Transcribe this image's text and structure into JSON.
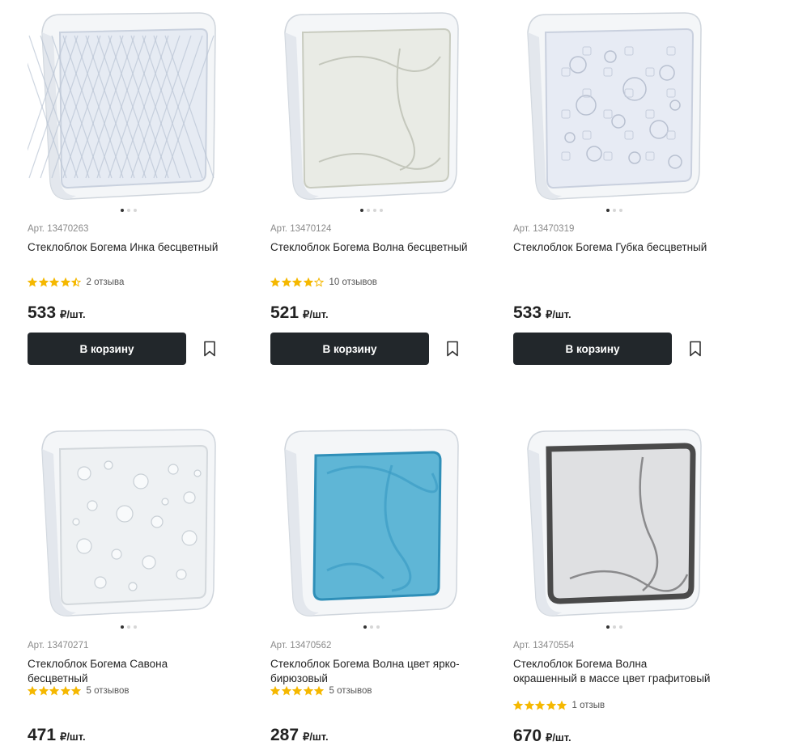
{
  "products": [
    {
      "article": "Арт. 13470263",
      "title": "Стеклоблок Богема Инка бесцветный",
      "rating": 4.5,
      "reviews": "2 отзыва",
      "price": "533",
      "unit": "₽/шт.",
      "button": "В корзину",
      "pattern": "diamond",
      "tint": "#e6ebf3",
      "edge": "#c9d1de",
      "dots": 3,
      "active_dot": 1,
      "rating_color": "#f5b800"
    },
    {
      "article": "Арт. 13470124",
      "title": "Стеклоблок Богема Волна бесцветный",
      "rating": 4,
      "reviews": "10 отзывов",
      "price": "521",
      "unit": "₽/шт.",
      "button": "В корзину",
      "pattern": "wave",
      "tint": "#e9ebe5",
      "edge": "#c8cbbf",
      "dots": 4,
      "active_dot": 1,
      "rating_color": "#f5b800"
    },
    {
      "article": "Арт. 13470319",
      "title": "Стеклоблок Богема Губка бесцветный",
      "rating": 0,
      "reviews": "",
      "price": "533",
      "unit": "₽/шт.",
      "button": "В корзину",
      "pattern": "sponge",
      "tint": "#e7ebf4",
      "edge": "#c9d0de",
      "dots": 3,
      "active_dot": 1,
      "rating_color": "#f5b800"
    },
    {
      "article": "Арт. 13470271",
      "title": "Стеклоблок Богема Савона бесцветный",
      "rating": 5,
      "reviews": "5 отзывов",
      "price": "471",
      "unit": "₽/шт.",
      "button": "",
      "pattern": "bubbles",
      "tint": "#eef1f3",
      "edge": "#d3d8dc",
      "dots": 3,
      "active_dot": 1,
      "rating_color": "#f5b800"
    },
    {
      "article": "Арт. 13470562",
      "title": "Стеклоблок Богема Волна цвет ярко-бирюзовый",
      "rating": 5,
      "reviews": "5 отзывов",
      "price": "287",
      "unit": "₽/шт.",
      "button": "",
      "pattern": "turquoise",
      "tint": "#5fb6d6",
      "edge": "#2f8fb8",
      "dots": 3,
      "active_dot": 1,
      "rating_color": "#f5b800"
    },
    {
      "article": "Арт. 13470554",
      "title": "Стеклоблок Богема Волна окрашенный в массе цвет графитовый",
      "rating": 5,
      "reviews": "1 отзыв",
      "price": "670",
      "unit": "₽/шт.",
      "button": "",
      "pattern": "graphite",
      "tint": "#dfe0e2",
      "edge": "#4a4a4a",
      "dots": 3,
      "active_dot": 1,
      "rating_color": "#f5b800"
    }
  ]
}
